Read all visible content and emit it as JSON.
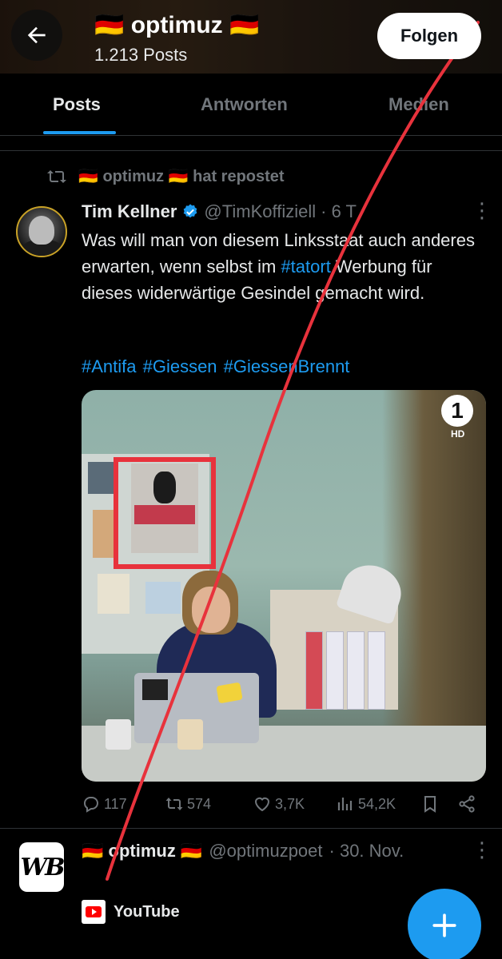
{
  "header": {
    "title": "🇩🇪 optimuz 🇩🇪",
    "post_count": "1.213 Posts",
    "follow_label": "Folgen"
  },
  "tabs": [
    {
      "label": "Posts",
      "active": true
    },
    {
      "label": "Antworten",
      "active": false
    },
    {
      "label": "Medien",
      "active": false
    }
  ],
  "repost": {
    "text": "🇩🇪 optimuz 🇩🇪 hat repostet"
  },
  "tweet1": {
    "name": "Tim Kellner",
    "handle": "@TimKoffiziell",
    "time": "· 6 T",
    "text_part1": "Was will man von diesem Linksstaat auch anderes erwarten, wenn selbst im ",
    "text_hashtag": "#tatort",
    "text_part2": " Werbung für dieses widerwärtige Gesindel gemacht wird.",
    "hashtags": "#Antifa #Giessen #GiessenBrennt",
    "media": {
      "channel_logo": "1",
      "channel_badge": "HD"
    },
    "stats": {
      "replies": "117",
      "reposts": "574",
      "likes": "3,7K",
      "views": "54,2K"
    }
  },
  "tweet2": {
    "avatar_text": "WB",
    "name": "🇩🇪 optimuz 🇩🇪",
    "handle": "@optimuzpoet",
    "time": "· 30. Nov.",
    "link_label": "YouTube"
  },
  "colors": {
    "accent": "#1d9bf0",
    "background": "#000000",
    "muted": "#71767b",
    "annotation_red": "#e8323c"
  }
}
